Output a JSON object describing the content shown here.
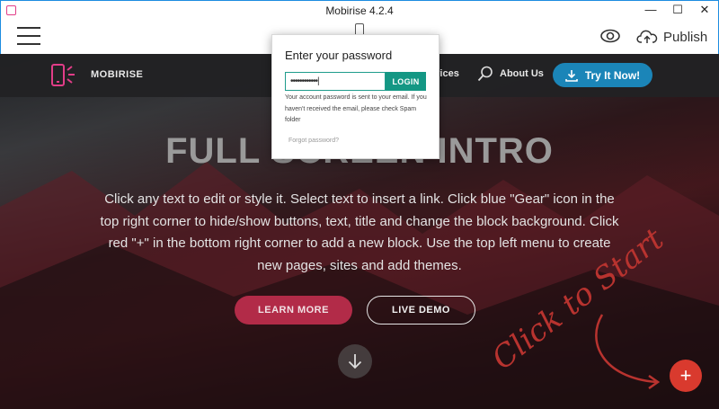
{
  "window": {
    "title": "Mobirise 4.2.4",
    "minimize": "—",
    "maximize": "☐",
    "close": "✕"
  },
  "toolbar": {
    "publish_label": "Publish"
  },
  "site": {
    "brand": "MOBIRISE",
    "nav_services": "rvices",
    "nav_about": "About Us",
    "try_label": "Try It Now!",
    "headline": "FULL SCREEN INTRO",
    "intro": "Click any text to edit or style it. Select text to insert a link. Click blue \"Gear\" icon in the top right corner to hide/show buttons, text, title and change the block background. Click red \"+\" in the bottom right corner to add a new block. Use the top left menu to create new pages, sites and add themes.",
    "learn_more": "LEARN MORE",
    "live_demo": "LIVE DEMO",
    "click_to_start": "Click to Start",
    "fab_label": "+"
  },
  "modal": {
    "title": "Enter your password",
    "password_value": "••••••••••••|",
    "login_label": "LOGIN",
    "note": "Your account password is sent to your email. If you haven't received the email, please check Spam folder",
    "forgot_label": "Forgot password?"
  },
  "colors": {
    "accent_teal": "#149784",
    "brand_pink": "#e23d88",
    "fab_red": "#d93a2e",
    "try_blue": "#1b85b8"
  }
}
